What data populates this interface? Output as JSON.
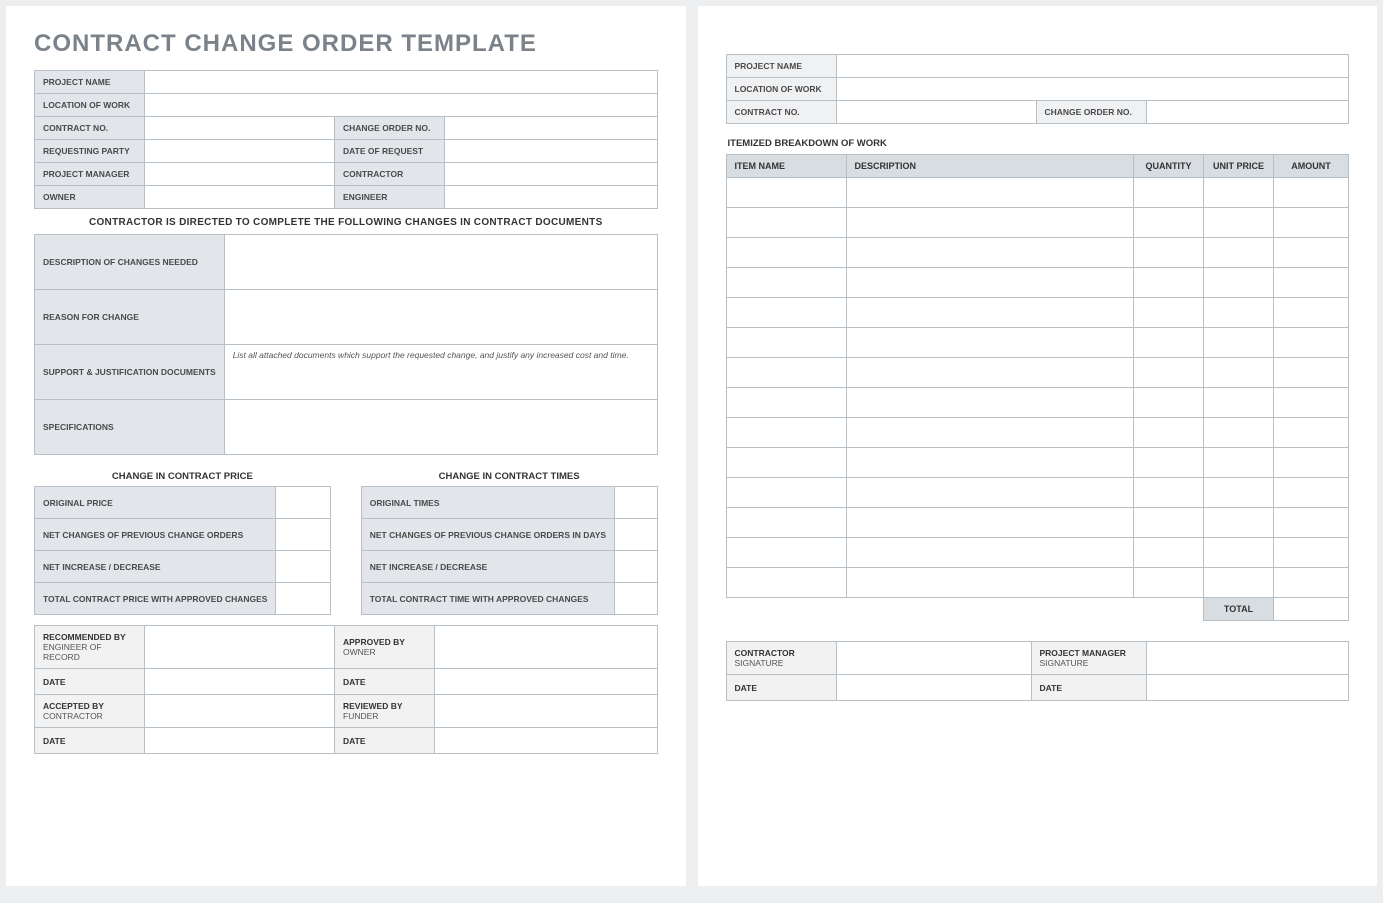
{
  "title": "CONTRACT CHANGE ORDER TEMPLATE",
  "hdr": {
    "project_name": "PROJECT NAME",
    "location": "LOCATION OF WORK",
    "contract_no": "CONTRACT NO.",
    "change_order_no": "CHANGE ORDER NO.",
    "requesting_party": "REQUESTING PARTY",
    "date_of_request": "DATE OF REQUEST",
    "project_manager": "PROJECT MANAGER",
    "contractor": "CONTRACTOR",
    "owner": "OWNER",
    "engineer": "ENGINEER"
  },
  "banner": "CONTRACTOR IS DIRECTED TO COMPLETE THE FOLLOWING CHANGES IN CONTRACT DOCUMENTS",
  "changes": {
    "desc_label": "DESCRIPTION OF CHANGES NEEDED",
    "reason_label": "REASON FOR CHANGE",
    "support_label": "SUPPORT & JUSTIFICATION DOCUMENTS",
    "support_hint": "List all attached documents which support the requested change, and justify any increased cost and time.",
    "spec_label": "SPECIFICATIONS"
  },
  "price": {
    "section": "CHANGE IN CONTRACT PRICE",
    "original": "ORIGINAL PRICE",
    "net_prev": "NET CHANGES OF PREVIOUS CHANGE ORDERS",
    "net_incdec": "NET INCREASE / DECREASE",
    "total": "TOTAL CONTRACT PRICE WITH APPROVED CHANGES"
  },
  "times": {
    "section": "CHANGE IN CONTRACT TIMES",
    "original": "ORIGINAL TIMES",
    "net_prev": "NET CHANGES OF PREVIOUS CHANGE ORDERS IN DAYS",
    "net_incdec": "NET INCREASE / DECREASE",
    "total": "TOTAL CONTRACT TIME WITH APPROVED CHANGES"
  },
  "sign1": {
    "recommended_by": "RECOMMENDED BY",
    "recommended_sub": "ENGINEER OF RECORD",
    "approved_by": "APPROVED BY",
    "approved_sub": "OWNER",
    "accepted_by": "ACCEPTED BY",
    "accepted_sub": "CONTRACTOR",
    "reviewed_by": "REVIEWED BY",
    "reviewed_sub": "FUNDER",
    "date": "DATE"
  },
  "page2": {
    "itemized_title": "ITEMIZED BREAKDOWN OF WORK",
    "cols": {
      "item": "ITEM NAME",
      "desc": "DESCRIPTION",
      "qty": "QUANTITY",
      "unit": "UNIT PRICE",
      "amount": "AMOUNT"
    },
    "total": "TOTAL",
    "sign": {
      "contractor": "CONTRACTOR",
      "signature": "SIGNATURE",
      "pm": "PROJECT MANAGER",
      "date": "DATE"
    }
  }
}
